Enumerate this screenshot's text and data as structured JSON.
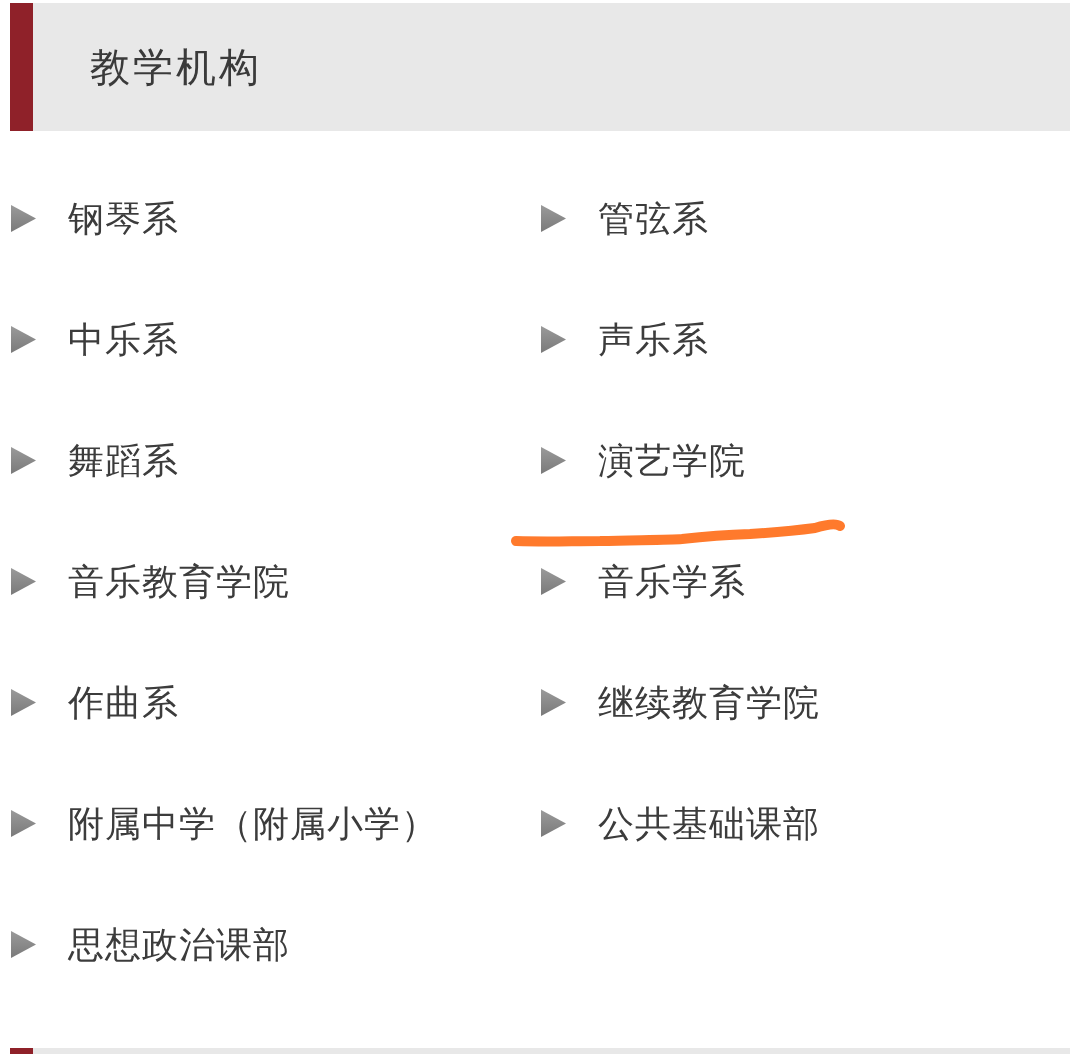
{
  "header": {
    "title": "教学机构"
  },
  "units": [
    {
      "name": "钢琴系",
      "underlined": false
    },
    {
      "name": "管弦系",
      "underlined": false
    },
    {
      "name": "中乐系",
      "underlined": false
    },
    {
      "name": "声乐系",
      "underlined": false
    },
    {
      "name": "舞蹈系",
      "underlined": false
    },
    {
      "name": "演艺学院",
      "underlined": true
    },
    {
      "name": "音乐教育学院",
      "underlined": false
    },
    {
      "name": "音乐学系",
      "underlined": false
    },
    {
      "name": "作曲系",
      "underlined": false
    },
    {
      "name": "继续教育学院",
      "underlined": false
    },
    {
      "name": "附属中学（附属小学）",
      "underlined": false
    },
    {
      "name": "公共基础课部",
      "underlined": false
    },
    {
      "name": "思想政治课部",
      "underlined": false
    }
  ]
}
